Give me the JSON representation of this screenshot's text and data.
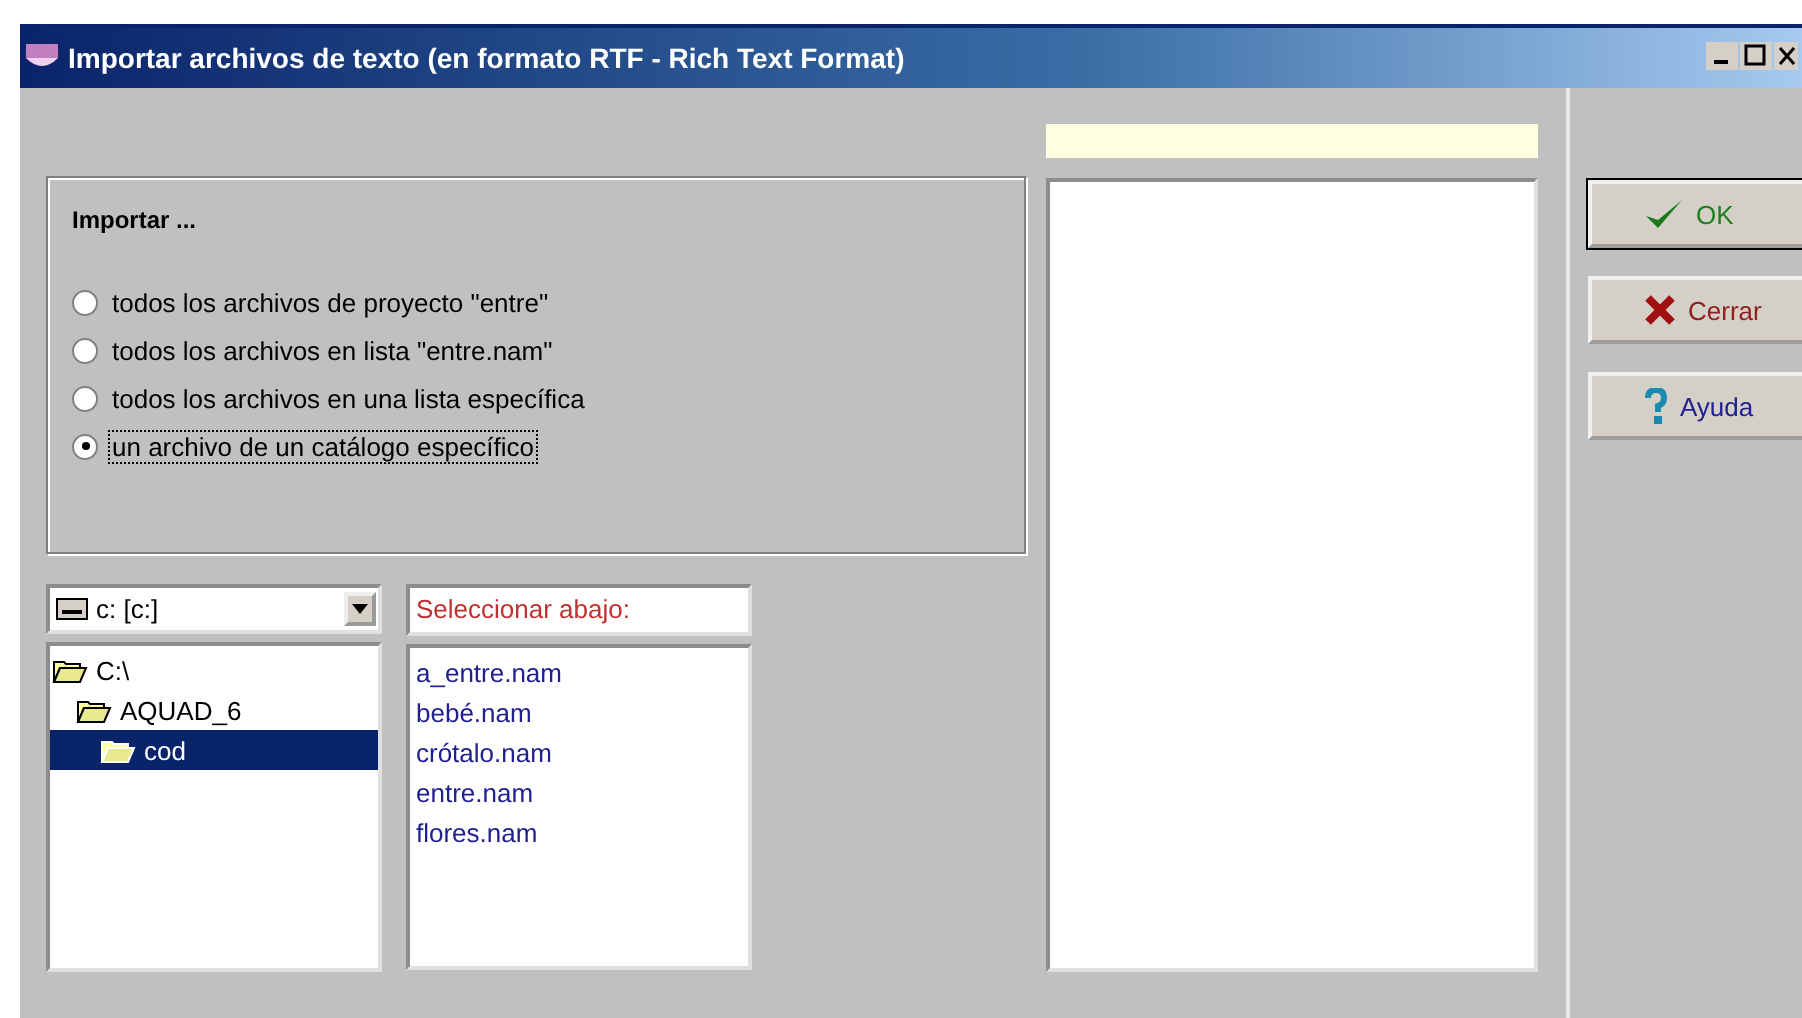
{
  "window": {
    "title": "Importar archivos de texto (en formato RTF - Rich Text Format)"
  },
  "import_group": {
    "title": "Importar ...",
    "options": [
      {
        "label": "todos los archivos de proyecto \"entre\"",
        "selected": false
      },
      {
        "label": "todos los archivos en lista \"entre.nam\"",
        "selected": false
      },
      {
        "label": "todos los archivos en una lista específica",
        "selected": false
      },
      {
        "label": "un archivo de un catálogo específico",
        "selected": true
      }
    ]
  },
  "drive": {
    "value": "c: [c:]"
  },
  "folders": [
    {
      "label": "C:\\",
      "selected": false,
      "children": [
        {
          "label": "AQUAD_6",
          "selected": false,
          "children": [
            {
              "label": "cod",
              "selected": true
            }
          ]
        }
      ]
    }
  ],
  "file_header": "Seleccionar abajo:",
  "files": [
    "a_entre.nam",
    "bebé.nam",
    "crótalo.nam",
    "entre.nam",
    "flores.nam"
  ],
  "buttons": [
    {
      "kind": "ok",
      "label": "OK"
    },
    {
      "kind": "close",
      "label": "Cerrar"
    },
    {
      "kind": "help",
      "label": "Ayuda"
    }
  ]
}
